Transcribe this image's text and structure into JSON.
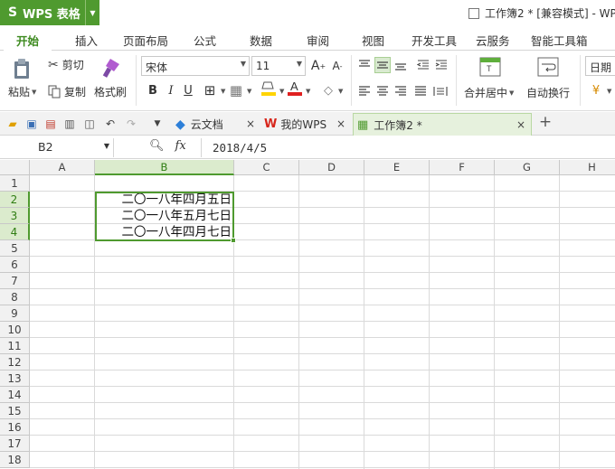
{
  "app": {
    "name": "WPS 表格",
    "logo": "S"
  },
  "window_title": "工作簿2 * [兼容模式] - WP",
  "ribbon_tabs": [
    "开始",
    "插入",
    "页面布局",
    "公式",
    "数据",
    "审阅",
    "视图",
    "开发工具",
    "云服务",
    "智能工具箱"
  ],
  "toolbar": {
    "paste_label": "粘贴",
    "cut_label": "剪切",
    "copy_label": "复制",
    "format_painter_label": "格式刷",
    "font_name": "宋体",
    "font_size": "11",
    "merge_center_label": "合并居中",
    "wrap_text_label": "自动换行",
    "number_format": "日期"
  },
  "doc_tabs": [
    {
      "label": "云文档"
    },
    {
      "label": "我的WPS"
    },
    {
      "label": "工作簿2 *"
    }
  ],
  "formula_bar": {
    "name_box": "B2",
    "fx_label": "fx",
    "formula": "2018/4/5"
  },
  "sheet": {
    "columns": [
      "A",
      "B",
      "C",
      "D",
      "E",
      "F",
      "G",
      "H"
    ],
    "rows": [
      "1",
      "2",
      "3",
      "4",
      "5",
      "6",
      "7",
      "8",
      "9",
      "10",
      "11",
      "12",
      "13",
      "14",
      "15",
      "16",
      "17",
      "18"
    ],
    "selected_column": "B",
    "selected_rows": [
      "2",
      "3",
      "4"
    ],
    "cells": {
      "B2": "二〇一八年四月五日",
      "B3": "二〇一八年五月七日",
      "B4": "二〇一八年四月七日"
    }
  },
  "colors": {
    "accent": "#4f9a2f",
    "header_bg": "#f1f1f1",
    "selection_header_bg": "#dbebcd"
  }
}
